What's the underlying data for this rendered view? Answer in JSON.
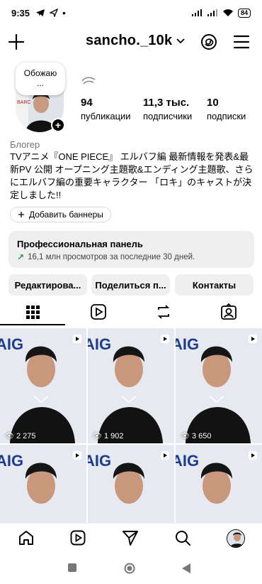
{
  "status_bar": {
    "time": "9:35",
    "battery": "84"
  },
  "header": {
    "username": "sancho._10k"
  },
  "profile": {
    "note": "Обожаю\n...",
    "stats": [
      {
        "value": "94",
        "label": "публикации"
      },
      {
        "value": "11,3 тыс.",
        "label": "подписчики"
      },
      {
        "value": "10",
        "label": "подписки"
      }
    ],
    "category": "Блогер",
    "bio": "TVアニメ『ONE PIECE』 エルバフ編 最新情報を発表&最新PV 公開 オープニング主題歌&エンディング主題歌、さらにエルバフ編の重要キャラクター 「ロキ」のキャストが決定しました!!",
    "add_banners": "Добавить баннеры"
  },
  "pro_panel": {
    "title": "Профессиональная панель",
    "subtitle": "16,1 млн просмотров за последние 30 дней."
  },
  "buttons": {
    "edit": "Редактирова...",
    "share": "Поделиться п...",
    "contacts": "Контакты"
  },
  "grid": {
    "posts": [
      {
        "views": "2 275"
      },
      {
        "views": "1 902"
      },
      {
        "views": "3 650"
      },
      {
        "views": ""
      },
      {
        "views": ""
      },
      {
        "views": ""
      }
    ],
    "thumb_text": "AIG"
  },
  "colors": {
    "accent_green": "#1a9c3a",
    "panel_bg": "#efefef"
  }
}
